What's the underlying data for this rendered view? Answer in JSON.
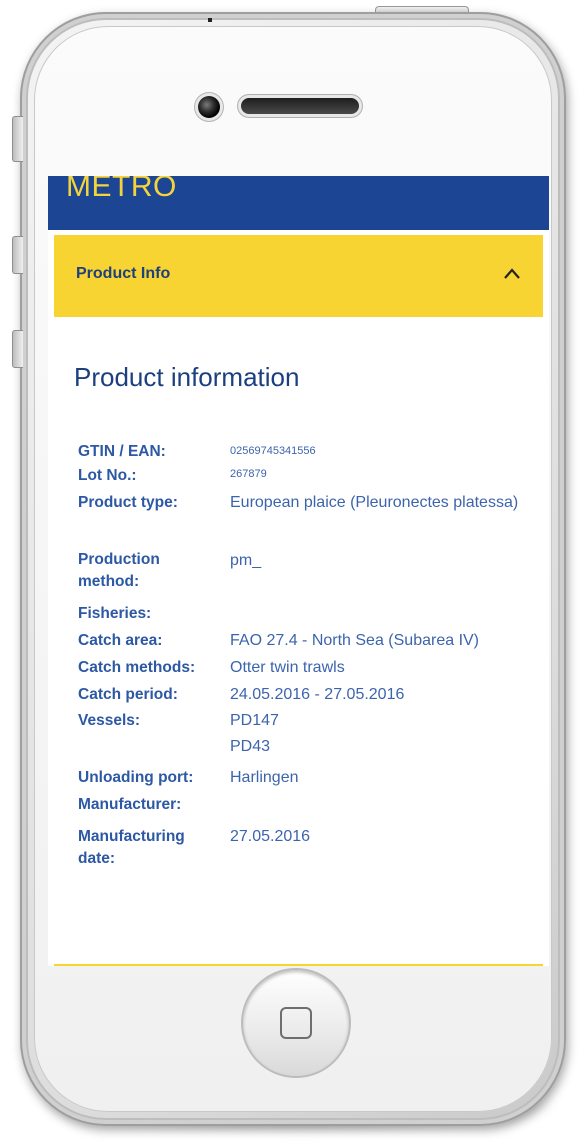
{
  "app": {
    "brand": "METRO"
  },
  "accordion": {
    "title": "Product Info",
    "state_icon": "chevron-up-icon"
  },
  "section": {
    "title": "Product information"
  },
  "fields": [
    {
      "label": "GTIN / EAN:",
      "value": "02569745341556"
    },
    {
      "label": "Lot No.:",
      "value": "267879"
    },
    {
      "label": "Product type:",
      "value": "European plaice (Pleuronectes platessa)"
    },
    {
      "label": "Production method:",
      "value": "pm_"
    },
    {
      "label": "Fisheries:",
      "value": ""
    },
    {
      "label": "Catch area:",
      "value": "FAO 27.4 - North Sea (Subarea IV)"
    },
    {
      "label": "Catch methods:",
      "value": "Otter twin trawls"
    },
    {
      "label": "Catch period:",
      "value": "24.05.2016 - 27.05.2016"
    },
    {
      "label": "Vessels:",
      "value": "PD147",
      "value2": "PD43"
    },
    {
      "label": "Unloading port:",
      "value": "Harlingen"
    },
    {
      "label": "Manufacturer:",
      "value": ""
    },
    {
      "label": "Manufacturing date:",
      "value": "27.05.2016"
    }
  ],
  "colors": {
    "header": "#1c4594",
    "accent": "#f7d431",
    "label": "#2c58a4",
    "value": "#3c64ad"
  }
}
